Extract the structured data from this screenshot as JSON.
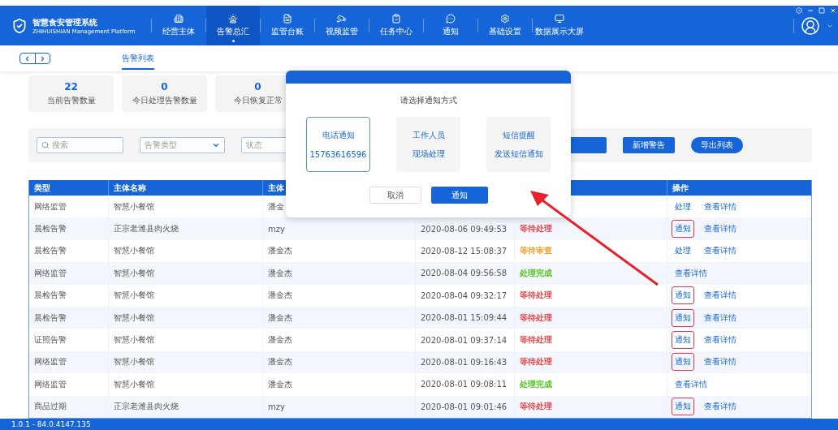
{
  "header": {
    "title": "智慧食安管理系统",
    "subtitle": "ZHIHUISHIAN Management Platform",
    "nav": [
      {
        "label": "经营主体",
        "selected": false
      },
      {
        "label": "告警总汇",
        "selected": true
      },
      {
        "label": "监管台账",
        "selected": false
      },
      {
        "label": "视频监管",
        "selected": false
      },
      {
        "label": "任务中心",
        "selected": false
      },
      {
        "label": "通知",
        "selected": false
      },
      {
        "label": "基础设置",
        "selected": false
      },
      {
        "label": "数据展示大屏",
        "selected": false
      }
    ]
  },
  "tabs": [
    {
      "label": "告警列表",
      "selected": true
    }
  ],
  "stats": [
    {
      "value": "22",
      "label": "当前告警数量"
    },
    {
      "value": "0",
      "label": "今日处理告警数量"
    },
    {
      "value": "0",
      "label": "今日恢复正常"
    }
  ],
  "filters": {
    "search_placeholder": "搜索",
    "type_placeholder": "告警类型",
    "status_placeholder": "状态",
    "buttons": [
      {
        "label": "新增警告",
        "kind": "rect"
      },
      {
        "label": "导出列表",
        "kind": "pill"
      }
    ]
  },
  "table": {
    "columns": [
      "类型",
      "主体名称",
      "主体"
    ],
    "action_column": "操作",
    "rows": [
      {
        "type": "网络监管",
        "name": "智慧小餐馆",
        "owner": "潘金",
        "actions": [
          {
            "label": "处理",
            "highlighted": false
          },
          {
            "label": "查看详情",
            "highlighted": false
          }
        ]
      },
      {
        "type": "晨检告警",
        "name": "正宗老潍县肉火烧",
        "owner": "mzy",
        "time": "2020-08-06 09:49:53",
        "status": {
          "label": "等待处理",
          "color": "#e8474a"
        },
        "actions": [
          {
            "label": "通知",
            "highlighted": true
          },
          {
            "label": "查看详情",
            "highlighted": false
          }
        ]
      },
      {
        "type": "晨检告警",
        "name": "智慧小餐馆",
        "owner": "潘金杰",
        "time": "2020-08-12 15:08:37",
        "status": {
          "label": "等待审查",
          "color": "#f0a030"
        },
        "actions": [
          {
            "label": "处理",
            "highlighted": false
          },
          {
            "label": "查看详情",
            "highlighted": false
          }
        ]
      },
      {
        "type": "网络监管",
        "name": "智慧小餐馆",
        "owner": "潘金杰",
        "time": "2020-08-04 09:56:58",
        "status": {
          "label": "处理完成",
          "color": "#52c41a"
        },
        "actions": [
          {
            "label": "查看详情",
            "highlighted": false
          }
        ]
      },
      {
        "type": "晨检告警",
        "name": "智慧小餐馆",
        "owner": "潘金杰",
        "time": "2020-08-04 09:32:17",
        "status": {
          "label": "等待处理",
          "color": "#e8474a"
        },
        "actions": [
          {
            "label": "通知",
            "highlighted": true
          },
          {
            "label": "查看详情",
            "highlighted": false
          }
        ]
      },
      {
        "type": "晨检告警",
        "name": "智慧小餐馆",
        "owner": "潘金杰",
        "time": "2020-08-01 15:09:44",
        "status": {
          "label": "等待处理",
          "color": "#e8474a"
        },
        "actions": [
          {
            "label": "通知",
            "highlighted": true
          },
          {
            "label": "查看详情",
            "highlighted": false
          }
        ]
      },
      {
        "type": "证照告警",
        "name": "智慧小餐馆",
        "owner": "潘金杰",
        "time": "2020-08-01 09:37:14",
        "status": {
          "label": "等待处理",
          "color": "#e8474a"
        },
        "actions": [
          {
            "label": "通知",
            "highlighted": true
          },
          {
            "label": "查看详情",
            "highlighted": false
          }
        ]
      },
      {
        "type": "网络监管",
        "name": "智慧小餐馆",
        "owner": "潘金杰",
        "time": "2020-08-01 09:16:43",
        "status": {
          "label": "等待处理",
          "color": "#e8474a"
        },
        "actions": [
          {
            "label": "通知",
            "highlighted": true
          },
          {
            "label": "查看详情",
            "highlighted": false
          }
        ]
      },
      {
        "type": "网络监管",
        "name": "智慧小餐馆",
        "owner": "潘金杰",
        "time": "2020-08-01 09:08:11",
        "status": {
          "label": "处理完成",
          "color": "#52c41a"
        },
        "actions": [
          {
            "label": "查看详情",
            "highlighted": false
          }
        ]
      },
      {
        "type": "商品过期",
        "name": "正宗老潍县肉火烧",
        "owner": "mzy",
        "time": "2020-08-01 09:01:46",
        "status": {
          "label": "等待处理",
          "color": "#e8474a"
        },
        "actions": [
          {
            "label": "通知",
            "highlighted": true
          },
          {
            "label": "查看详情",
            "highlighted": false
          }
        ]
      }
    ]
  },
  "dialog": {
    "title": "请选择通知方式",
    "options": [
      {
        "title": "电话通知",
        "detail": "15763616596",
        "selected": true
      },
      {
        "title": "工作人员",
        "detail": "现场处理",
        "selected": false
      },
      {
        "title": "短信提醒",
        "detail": "发送短信通知",
        "selected": false
      }
    ],
    "cancel": "取消",
    "confirm": "通知"
  },
  "status_bar": "1.0.1 - 84.0.4147.135"
}
